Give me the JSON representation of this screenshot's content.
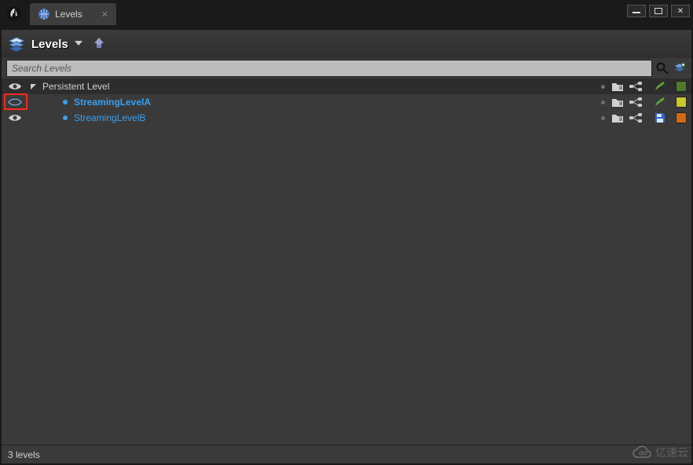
{
  "window": {
    "tab_label": "Levels",
    "search_placeholder": "Search Levels"
  },
  "toolbar": {
    "title": "Levels"
  },
  "levels": {
    "root": {
      "name": "Persistent Level"
    },
    "children": [
      {
        "name": "StreamingLevelA",
        "bold": true,
        "color": "#c8c82a",
        "save_needed": false
      },
      {
        "name": "StreamingLevelB",
        "bold": false,
        "color": "#d26a15",
        "save_needed": true
      }
    ]
  },
  "statusbar": {
    "count_text": "3 levels"
  },
  "watermark": {
    "text": "亿速云"
  },
  "colors": {
    "accent_blue": "#3aa0ef",
    "highlight_red": "#ff2a1a"
  }
}
